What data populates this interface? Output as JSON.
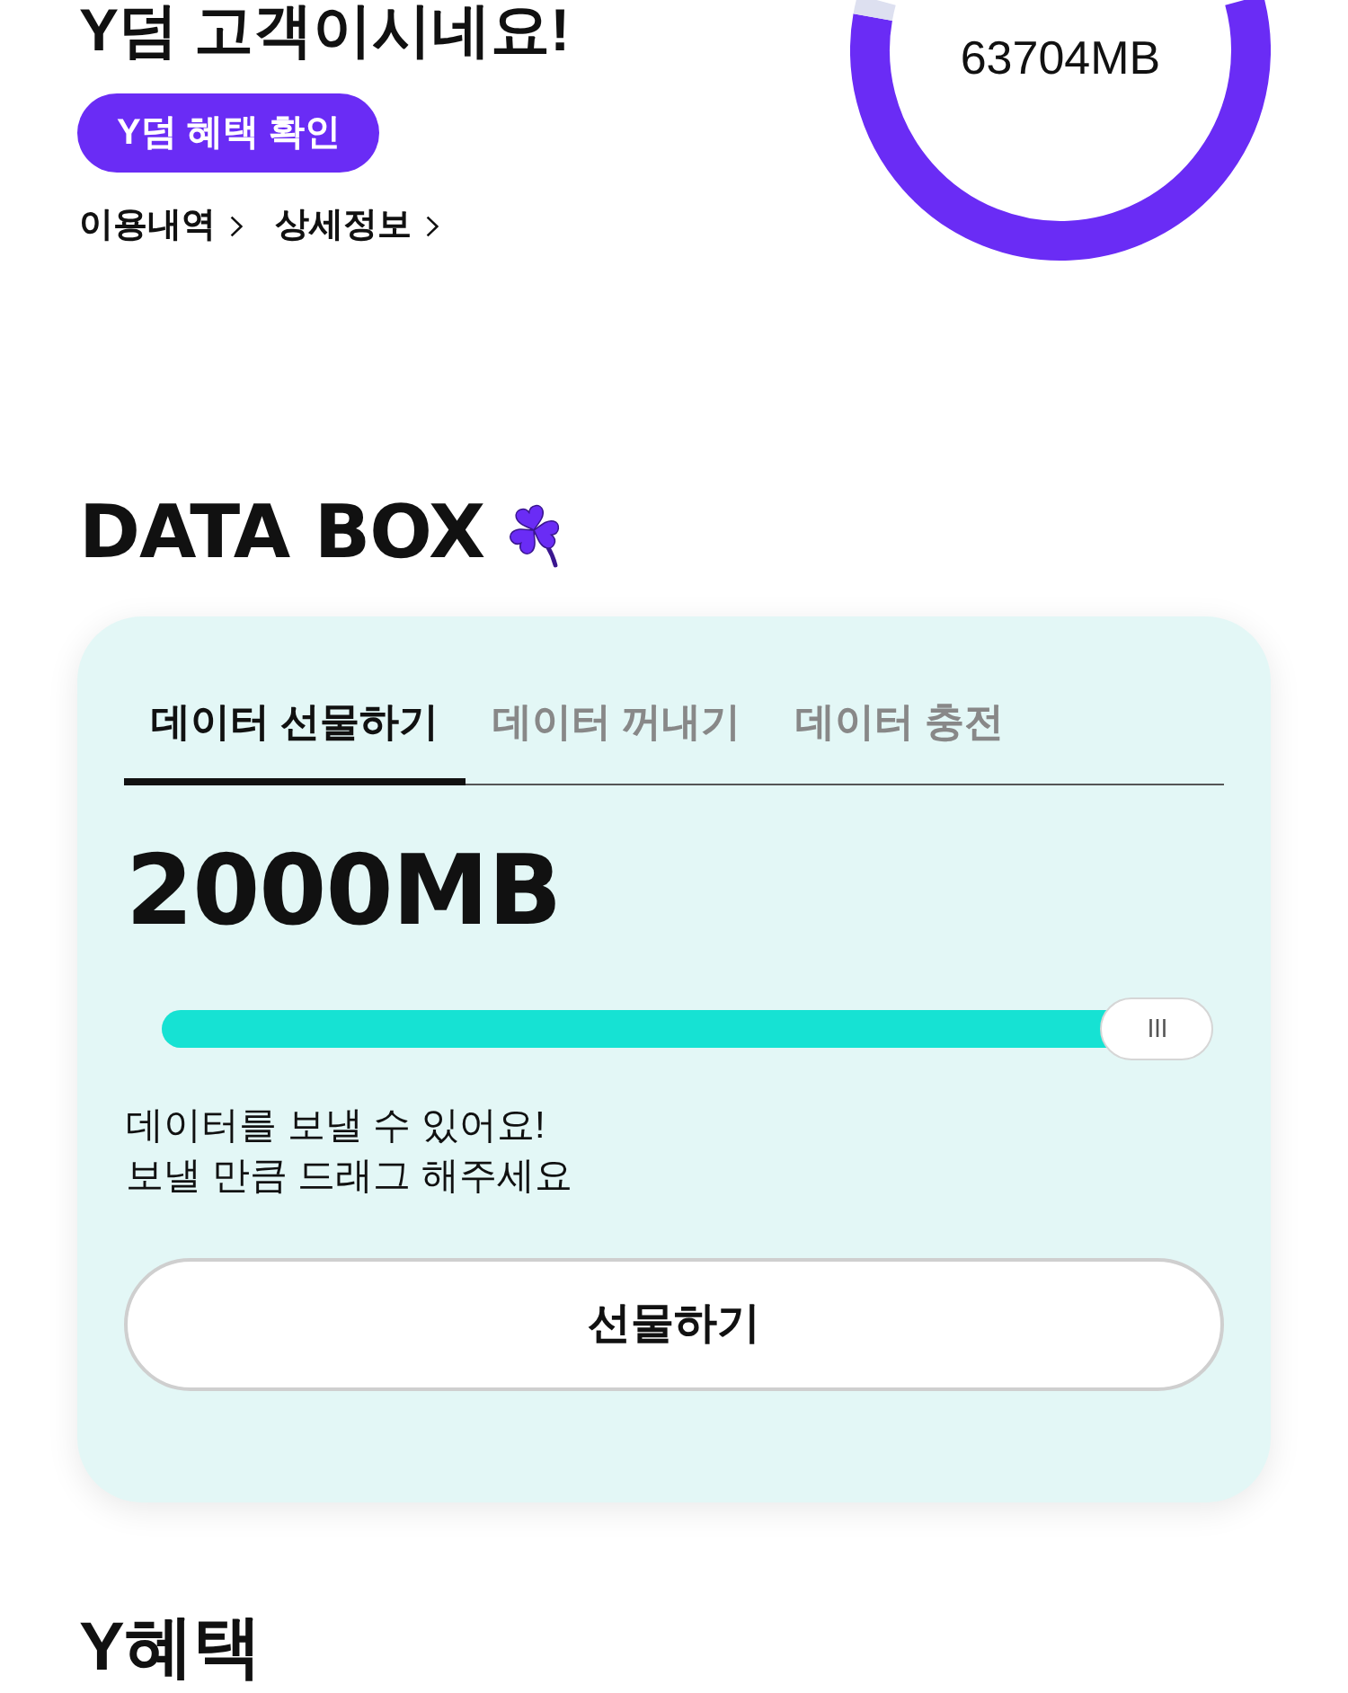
{
  "greeting": {
    "title": "Y덤 고객이시네요!",
    "benefit_button": "Y덤 혜택 확인",
    "links": [
      "이용내역",
      "상세정보"
    ]
  },
  "usage": {
    "remaining": "63704MB"
  },
  "data_box": {
    "title": "DATA BOX",
    "tabs": [
      {
        "label": "데이터 선물하기",
        "selected": true
      },
      {
        "label": "데이터 꺼내기",
        "selected": false
      },
      {
        "label": "데이터 충전",
        "selected": false
      }
    ],
    "amount": "2000MB",
    "slider": {
      "level": 1
    },
    "hint": "데이터를 보낼 수 있어요!\n보낼 만큼 드래그 해주세요",
    "action_button": "선물하기"
  },
  "next_section": {
    "title": "Y혜택"
  }
}
